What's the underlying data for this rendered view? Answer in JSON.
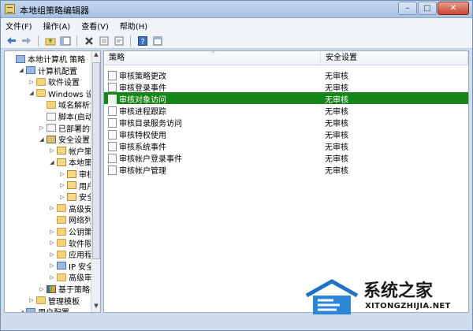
{
  "window": {
    "title": "本地组策略编辑器",
    "min": "–",
    "max": "□",
    "close": "✕"
  },
  "menu": [
    "文件(F)",
    "操作(A)",
    "查看(V)",
    "帮助(H)"
  ],
  "toolbar": [
    "back-icon",
    "forward-icon",
    "up-folder-icon",
    "show-hide-tree-icon",
    "delete-icon",
    "properties-icon",
    "export-icon",
    "help-icon",
    "extended-view-icon"
  ],
  "tree": [
    {
      "label": "本地计算机 策略",
      "icon": "pc",
      "level": 0,
      "tw": ""
    },
    {
      "label": "计算机配置",
      "icon": "pc",
      "level": 1,
      "tw": "◢"
    },
    {
      "label": "软件设置",
      "icon": "folder",
      "level": 2,
      "tw": "▷"
    },
    {
      "label": "Windows 设置",
      "icon": "folder",
      "level": 2,
      "tw": "◢"
    },
    {
      "label": "域名解析策",
      "icon": "folder",
      "level": 3,
      "tw": ""
    },
    {
      "label": "脚本(启动",
      "icon": "doc",
      "level": 3,
      "tw": ""
    },
    {
      "label": "已部署的打",
      "icon": "doc",
      "level": 3,
      "tw": "▷"
    },
    {
      "label": "安全设置",
      "icon": "shield",
      "level": 3,
      "tw": "◢"
    },
    {
      "label": "帐户策",
      "icon": "pol",
      "level": 4,
      "tw": "▷"
    },
    {
      "label": "本地策",
      "icon": "pol",
      "level": 4,
      "tw": "◢"
    },
    {
      "label": "审核",
      "icon": "pol",
      "level": 5,
      "tw": "▷"
    },
    {
      "label": "用户",
      "icon": "pol",
      "level": 5,
      "tw": "▷"
    },
    {
      "label": "安全",
      "icon": "pol",
      "level": 5,
      "tw": "▷"
    },
    {
      "label": "高级安",
      "icon": "folder",
      "level": 4,
      "tw": "▷"
    },
    {
      "label": "网络列",
      "icon": "folder",
      "level": 4,
      "tw": ""
    },
    {
      "label": "公钥策",
      "icon": "folder",
      "level": 4,
      "tw": "▷"
    },
    {
      "label": "软件限",
      "icon": "folder",
      "level": 4,
      "tw": "▷"
    },
    {
      "label": "应用程",
      "icon": "folder",
      "level": 4,
      "tw": "▷"
    },
    {
      "label": "IP 安全",
      "icon": "pc",
      "level": 4,
      "tw": "▷"
    },
    {
      "label": "高级审",
      "icon": "folder",
      "level": 4,
      "tw": "▷"
    },
    {
      "label": "基于策略的",
      "icon": "chart",
      "level": 3,
      "tw": "▷"
    },
    {
      "label": "管理模板",
      "icon": "folder",
      "level": 2,
      "tw": "▷"
    },
    {
      "label": "用户配置",
      "icon": "pc",
      "level": 1,
      "tw": "◢"
    }
  ],
  "list": {
    "columns": [
      "策略",
      "安全设置"
    ],
    "sort_glyph": "^",
    "rows": [
      {
        "policy": "审核策略更改",
        "setting": "无审核",
        "selected": false
      },
      {
        "policy": "审核登录事件",
        "setting": "无审核",
        "selected": false
      },
      {
        "policy": "审核对象访问",
        "setting": "无审核",
        "selected": true
      },
      {
        "policy": "审核进程跟踪",
        "setting": "无审核",
        "selected": false
      },
      {
        "policy": "审核目录服务访问",
        "setting": "无审核",
        "selected": false
      },
      {
        "policy": "审核特权使用",
        "setting": "无审核",
        "selected": false
      },
      {
        "policy": "审核系统事件",
        "setting": "无审核",
        "selected": false
      },
      {
        "policy": "审核帐户登录事件",
        "setting": "无审核",
        "selected": false
      },
      {
        "policy": "审核帐户管理",
        "setting": "无审核",
        "selected": false
      }
    ]
  },
  "watermark": {
    "text": "系统之家",
    "url": "XITONGZHIJIA.NET"
  }
}
